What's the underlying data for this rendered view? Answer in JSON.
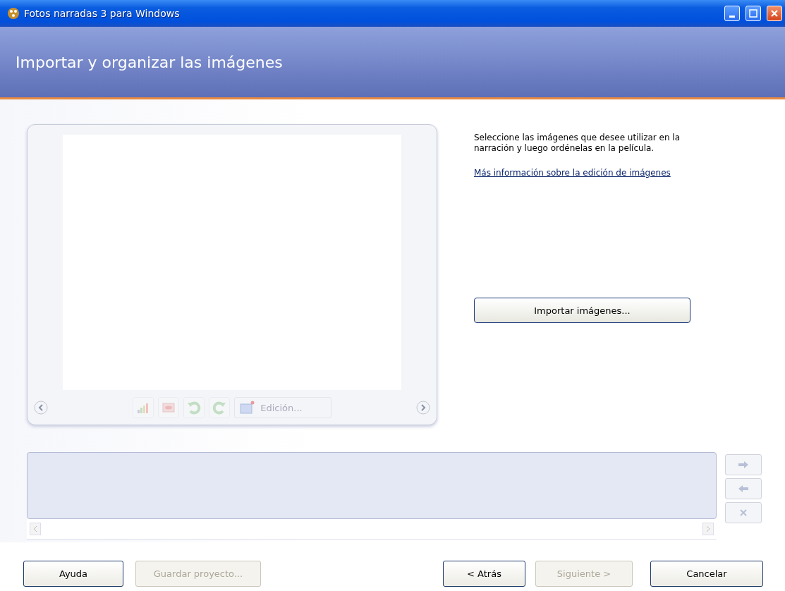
{
  "window": {
    "title": "Fotos narradas 3 para Windows"
  },
  "header": {
    "title": "Importar y organizar las imágenes"
  },
  "preview": {
    "toolbar": [
      {
        "kind": "levels",
        "disabled": true
      },
      {
        "kind": "redeye",
        "disabled": true
      },
      {
        "kind": "rotate-left",
        "disabled": true
      },
      {
        "kind": "rotate-right",
        "disabled": true
      }
    ],
    "edit_button": {
      "label": "Edición...",
      "disabled": true
    }
  },
  "instructions": "Seleccione las imágenes que desee utilizar en la narración y luego ordénelas en la película.",
  "help_link": "Más información sobre la edición de imágenes",
  "import_button": "Importar imágenes...",
  "filmstrip_buttons": [
    {
      "kind": "right",
      "disabled": true
    },
    {
      "kind": "left",
      "disabled": true
    },
    {
      "kind": "remove",
      "disabled": true
    }
  ],
  "footer": [
    {
      "label": "Ayuda",
      "disabled": false
    },
    {
      "label": "Guardar proyecto...",
      "disabled": true
    },
    {
      "label": "< Atrás",
      "disabled": false
    },
    {
      "label": "Siguiente >",
      "disabled": true
    },
    {
      "label": "Cancelar",
      "disabled": false
    }
  ]
}
